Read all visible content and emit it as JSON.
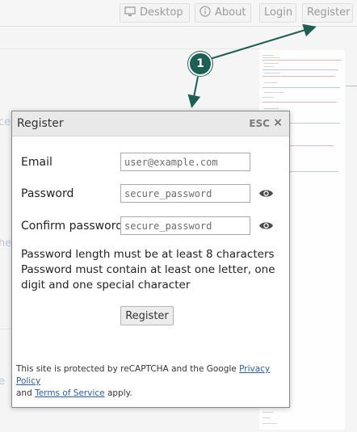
{
  "topbar": {
    "desktop_label": "Desktop",
    "about_label": "About",
    "login_label": "Login",
    "register_label": "Register"
  },
  "background": {
    "fragment_1": "ce",
    "fragment_2": "he",
    "fragment_3": "e"
  },
  "tour": {
    "step_number": "1",
    "accent_color": "#1b5f55"
  },
  "modal": {
    "title": "Register",
    "esc_label": "ESC",
    "close_symbol": "×",
    "email": {
      "label": "Email",
      "placeholder": "user@example.com"
    },
    "password": {
      "label": "Password",
      "placeholder": "secure_password"
    },
    "confirm": {
      "label": "Confirm password",
      "placeholder": "secure_password"
    },
    "hint_length": "Password length must be at least 8 characters",
    "hint_content": "Password must contain at least one letter, one digit and one special character",
    "submit_label": "Register",
    "recaptcha": {
      "prefix": "This site is protected by reCAPTCHA and the Google ",
      "privacy_link": "Privacy Policy",
      "and_text": "and ",
      "terms_link": "Terms of Service",
      "suffix": " apply."
    }
  }
}
